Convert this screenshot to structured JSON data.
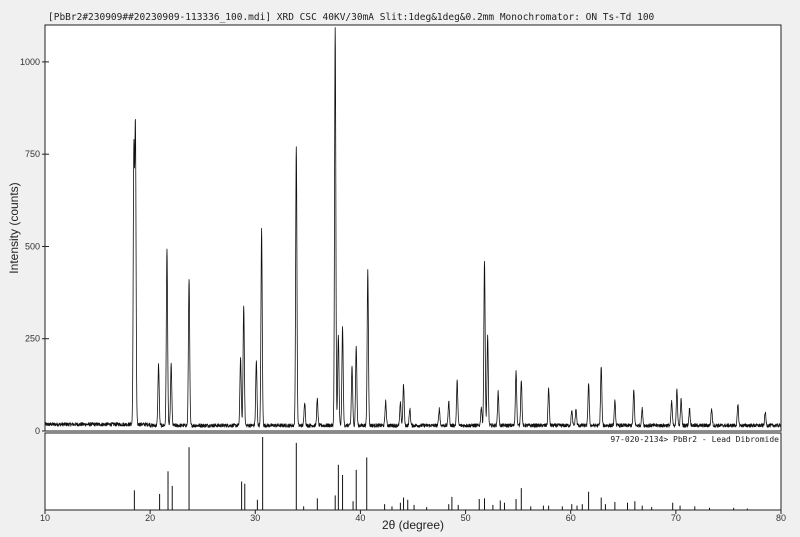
{
  "title": "[PbBr2#230909##20230909-113336_100.mdi] XRD CSC 40KV/30mA Slit:1deg&1deg&0.2mm Monochromator: ON Ts-Td 100",
  "chart_data": [
    {
      "type": "line",
      "xlabel": "",
      "ylabel": "Intensity (counts)",
      "xlim": [
        10,
        80
      ],
      "ylim": [
        0,
        1100
      ],
      "y_ticks": [
        0,
        250,
        500,
        750,
        1000
      ],
      "y_tick_labels": [
        "0",
        "250",
        "500",
        "750",
        "1000"
      ],
      "baseline": 15,
      "peaks": [
        {
          "x": 18.6,
          "y": 795
        },
        {
          "x": 18.45,
          "y": 730
        },
        {
          "x": 20.8,
          "y": 165
        },
        {
          "x": 21.6,
          "y": 478
        },
        {
          "x": 22.0,
          "y": 165
        },
        {
          "x": 23.7,
          "y": 400
        },
        {
          "x": 28.6,
          "y": 185
        },
        {
          "x": 28.9,
          "y": 325
        },
        {
          "x": 30.1,
          "y": 175
        },
        {
          "x": 30.6,
          "y": 530
        },
        {
          "x": 33.9,
          "y": 760
        },
        {
          "x": 34.7,
          "y": 65
        },
        {
          "x": 35.9,
          "y": 70
        },
        {
          "x": 37.6,
          "y": 1075
        },
        {
          "x": 37.9,
          "y": 245
        },
        {
          "x": 38.3,
          "y": 265
        },
        {
          "x": 39.2,
          "y": 160
        },
        {
          "x": 39.6,
          "y": 215
        },
        {
          "x": 40.7,
          "y": 420
        },
        {
          "x": 42.4,
          "y": 65
        },
        {
          "x": 43.8,
          "y": 60
        },
        {
          "x": 44.1,
          "y": 110
        },
        {
          "x": 44.7,
          "y": 45
        },
        {
          "x": 47.5,
          "y": 45
        },
        {
          "x": 48.4,
          "y": 65
        },
        {
          "x": 49.2,
          "y": 120
        },
        {
          "x": 51.5,
          "y": 50
        },
        {
          "x": 51.8,
          "y": 450
        },
        {
          "x": 52.1,
          "y": 240
        },
        {
          "x": 53.1,
          "y": 90
        },
        {
          "x": 54.8,
          "y": 150
        },
        {
          "x": 55.3,
          "y": 125
        },
        {
          "x": 57.9,
          "y": 100
        },
        {
          "x": 60.1,
          "y": 40
        },
        {
          "x": 60.5,
          "y": 45
        },
        {
          "x": 61.7,
          "y": 115
        },
        {
          "x": 62.9,
          "y": 160
        },
        {
          "x": 64.2,
          "y": 65
        },
        {
          "x": 66.0,
          "y": 95
        },
        {
          "x": 66.8,
          "y": 45
        },
        {
          "x": 69.6,
          "y": 65
        },
        {
          "x": 70.1,
          "y": 95
        },
        {
          "x": 70.5,
          "y": 70
        },
        {
          "x": 71.3,
          "y": 45
        },
        {
          "x": 73.4,
          "y": 45
        },
        {
          "x": 75.9,
          "y": 55
        },
        {
          "x": 78.5,
          "y": 35
        }
      ]
    },
    {
      "type": "bar",
      "label": "97-020-2134> PbBr2 - Lead Dibromide",
      "xlabel": "2θ (degree)",
      "xlim": [
        10,
        80
      ],
      "x_ticks": [
        10,
        20,
        30,
        40,
        50,
        60,
        70,
        80
      ],
      "x_tick_labels": [
        "10",
        "20",
        "30",
        "40",
        "50",
        "60",
        "70",
        "80"
      ],
      "ylim": [
        0,
        100
      ],
      "lines": [
        {
          "x": 18.5,
          "y": 27
        },
        {
          "x": 20.9,
          "y": 22
        },
        {
          "x": 21.7,
          "y": 53
        },
        {
          "x": 22.1,
          "y": 33
        },
        {
          "x": 23.7,
          "y": 86
        },
        {
          "x": 28.7,
          "y": 39
        },
        {
          "x": 29.0,
          "y": 36
        },
        {
          "x": 30.2,
          "y": 14
        },
        {
          "x": 30.7,
          "y": 100
        },
        {
          "x": 33.9,
          "y": 92
        },
        {
          "x": 34.6,
          "y": 5
        },
        {
          "x": 35.9,
          "y": 16
        },
        {
          "x": 37.6,
          "y": 20
        },
        {
          "x": 37.9,
          "y": 62
        },
        {
          "x": 38.3,
          "y": 48
        },
        {
          "x": 39.3,
          "y": 12
        },
        {
          "x": 39.6,
          "y": 55
        },
        {
          "x": 40.6,
          "y": 72
        },
        {
          "x": 42.3,
          "y": 8
        },
        {
          "x": 43.0,
          "y": 5
        },
        {
          "x": 43.8,
          "y": 10
        },
        {
          "x": 44.1,
          "y": 17
        },
        {
          "x": 44.5,
          "y": 14
        },
        {
          "x": 45.1,
          "y": 7
        },
        {
          "x": 46.3,
          "y": 4
        },
        {
          "x": 48.4,
          "y": 8
        },
        {
          "x": 48.7,
          "y": 18
        },
        {
          "x": 49.3,
          "y": 7
        },
        {
          "x": 51.3,
          "y": 15
        },
        {
          "x": 51.8,
          "y": 16
        },
        {
          "x": 52.6,
          "y": 7
        },
        {
          "x": 53.3,
          "y": 13
        },
        {
          "x": 53.7,
          "y": 10
        },
        {
          "x": 54.8,
          "y": 15
        },
        {
          "x": 55.3,
          "y": 30
        },
        {
          "x": 56.2,
          "y": 5
        },
        {
          "x": 57.4,
          "y": 6
        },
        {
          "x": 57.9,
          "y": 6
        },
        {
          "x": 59.2,
          "y": 5
        },
        {
          "x": 60.1,
          "y": 8
        },
        {
          "x": 60.6,
          "y": 6
        },
        {
          "x": 61.1,
          "y": 8
        },
        {
          "x": 61.7,
          "y": 25
        },
        {
          "x": 62.9,
          "y": 17
        },
        {
          "x": 63.3,
          "y": 8
        },
        {
          "x": 64.2,
          "y": 11
        },
        {
          "x": 65.4,
          "y": 10
        },
        {
          "x": 66.1,
          "y": 12
        },
        {
          "x": 66.8,
          "y": 6
        },
        {
          "x": 67.7,
          "y": 4
        },
        {
          "x": 69.7,
          "y": 10
        },
        {
          "x": 70.4,
          "y": 6
        },
        {
          "x": 71.8,
          "y": 5
        },
        {
          "x": 73.2,
          "y": 3
        },
        {
          "x": 75.5,
          "y": 3
        },
        {
          "x": 76.8,
          "y": 2
        }
      ]
    }
  ]
}
